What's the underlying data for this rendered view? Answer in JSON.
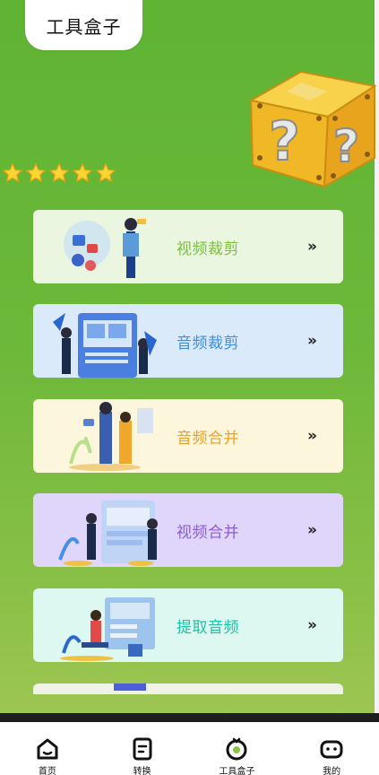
{
  "header": {
    "title": "工具盒子"
  },
  "rating": {
    "stars": 5
  },
  "tools": [
    {
      "label": "视频裁剪",
      "bg": "#eaf6e0",
      "color": "#7cc13c",
      "chevron": "»"
    },
    {
      "label": "音频裁剪",
      "bg": "#dbeafb",
      "color": "#3a8ee6",
      "chevron": "»"
    },
    {
      "label": "音频合并",
      "bg": "#fcf6dd",
      "color": "#f0a020",
      "chevron": "»"
    },
    {
      "label": "视频合并",
      "bg": "#e0d6fb",
      "color": "#8a5cd8",
      "chevron": "»"
    },
    {
      "label": "提取音频",
      "bg": "#ddf7f1",
      "color": "#1cc4a4",
      "chevron": "»"
    }
  ],
  "tabbar": [
    {
      "label": "首页",
      "icon": "home-icon"
    },
    {
      "label": "转换",
      "icon": "convert-icon"
    },
    {
      "label": "工具盒子",
      "icon": "toolbox-icon",
      "active": true
    },
    {
      "label": "我的",
      "icon": "profile-icon"
    }
  ]
}
